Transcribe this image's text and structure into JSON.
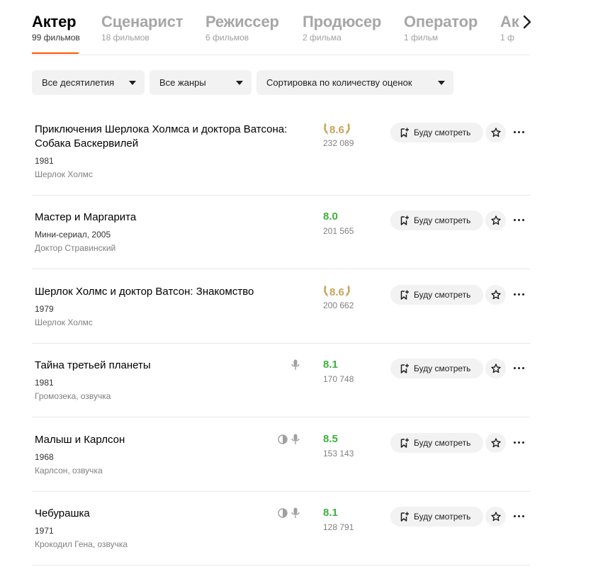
{
  "tabs": [
    {
      "label": "Актер",
      "count": "99 фильмов",
      "active": true
    },
    {
      "label": "Сценарист",
      "count": "18 фильмов"
    },
    {
      "label": "Режиссер",
      "count": "6 фильмов"
    },
    {
      "label": "Продюсер",
      "count": "2 фильма"
    },
    {
      "label": "Оператор",
      "count": "1 фильм"
    },
    {
      "label": "Ак",
      "count": "1 ф"
    }
  ],
  "filters": {
    "decades": "Все десятилетия",
    "genres": "Все жанры",
    "sort": "Сортировка по количеству оценок"
  },
  "watch_label": "Буду смотреть",
  "films": [
    {
      "title": "Приключения Шерлока Холмса и доктора Ватсона: Собака Баскервилей",
      "meta": "1981",
      "role": "Шерлок Холмс",
      "rating": "8.6",
      "votes": "232 089",
      "top": true
    },
    {
      "title": "Мастер и Маргарита",
      "meta": "Мини-сериал, 2005",
      "role": "Доктор Стравинский",
      "rating": "8.0",
      "votes": "201 565"
    },
    {
      "title": "Шерлок Холмс и доктор Ватсон: Знакомство",
      "meta": "1979",
      "role": "Шерлок Холмс",
      "rating": "8.6",
      "votes": "200 662",
      "top": true
    },
    {
      "title": "Тайна третьей планеты",
      "meta": "1981",
      "role": "Громозека, озвучка",
      "rating": "8.1",
      "votes": "170 748",
      "icons": [
        "microphone-icon"
      ]
    },
    {
      "title": "Малыш и Карлсон",
      "meta": "1968",
      "role": "Карлсон, озвучка",
      "rating": "8.5",
      "votes": "153 143",
      "icons": [
        "contrast-icon",
        "microphone-icon"
      ]
    },
    {
      "title": "Чебурашка",
      "meta": "1971",
      "role": "Крокодил Гена, озвучка",
      "rating": "8.1",
      "votes": "128 791",
      "icons": [
        "contrast-icon",
        "microphone-icon"
      ]
    }
  ],
  "colors": {
    "accent": "#ff5500",
    "rating_green": "#3bb33b",
    "rating_gold": "#c8a45a"
  }
}
